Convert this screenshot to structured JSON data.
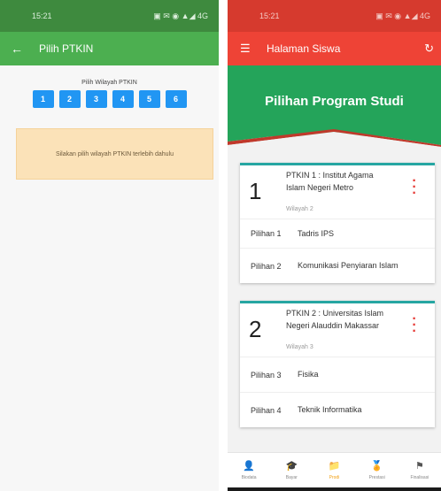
{
  "left": {
    "status": {
      "time": "15:21",
      "icons": "▣ ✉ ◉ ▲◢ 4G"
    },
    "header": {
      "title": "Pilih PTKIN"
    },
    "region": {
      "label": "Pilih Wilayah PTKIN",
      "buttons": [
        "1",
        "2",
        "3",
        "4",
        "5",
        "6"
      ]
    },
    "notice": "Silakan pilih wilayah PTKIN terlebih dahulu"
  },
  "right": {
    "status": {
      "time": "15:21",
      "icons": "▣ ✉ ◉ ▲◢ 4G"
    },
    "header": {
      "title": "Halaman Siswa"
    },
    "hero_title": "Pilihan Program Studi",
    "cards": [
      {
        "number": "1",
        "institution": "PTKIN 1 : Institut Agama Islam Negeri Metro",
        "region": "Wilayah 2",
        "choices": [
          {
            "label": "Pilihan 1",
            "value": "Tadris IPS"
          },
          {
            "label": "Pilihan 2",
            "value": "Komunikasi Penyiaran Islam"
          }
        ]
      },
      {
        "number": "2",
        "institution": "PTKIN 2 : Universitas Islam Negeri Alauddin Makassar",
        "region": "Wilayah 3",
        "choices": [
          {
            "label": "Pilihan 3",
            "value": "Fisika"
          },
          {
            "label": "Pilihan 4",
            "value": "Teknik Informatika"
          }
        ]
      }
    ],
    "nav": [
      {
        "label": "Biodata",
        "icon": "person-icon",
        "glyph": "👤"
      },
      {
        "label": "Bayar",
        "icon": "graduation-cap-icon",
        "glyph": "🎓"
      },
      {
        "label": "Prodi",
        "icon": "folder-icon",
        "glyph": "📁"
      },
      {
        "label": "Prestasi",
        "icon": "medal-icon",
        "glyph": "🏅"
      },
      {
        "label": "Finalisasi",
        "icon": "flag-icon",
        "glyph": "⚑"
      }
    ],
    "active_nav": "Prodi"
  },
  "colors": {
    "left_appbar": "#4caf50",
    "right_appbar": "#ee4336",
    "hero": "#24a45a",
    "region_button": "#2196f3",
    "notice_bg": "#fbe2b8",
    "card_accent": "#26a6a2",
    "menu_dots": "#e53935",
    "nav_active": "#f2a012"
  }
}
